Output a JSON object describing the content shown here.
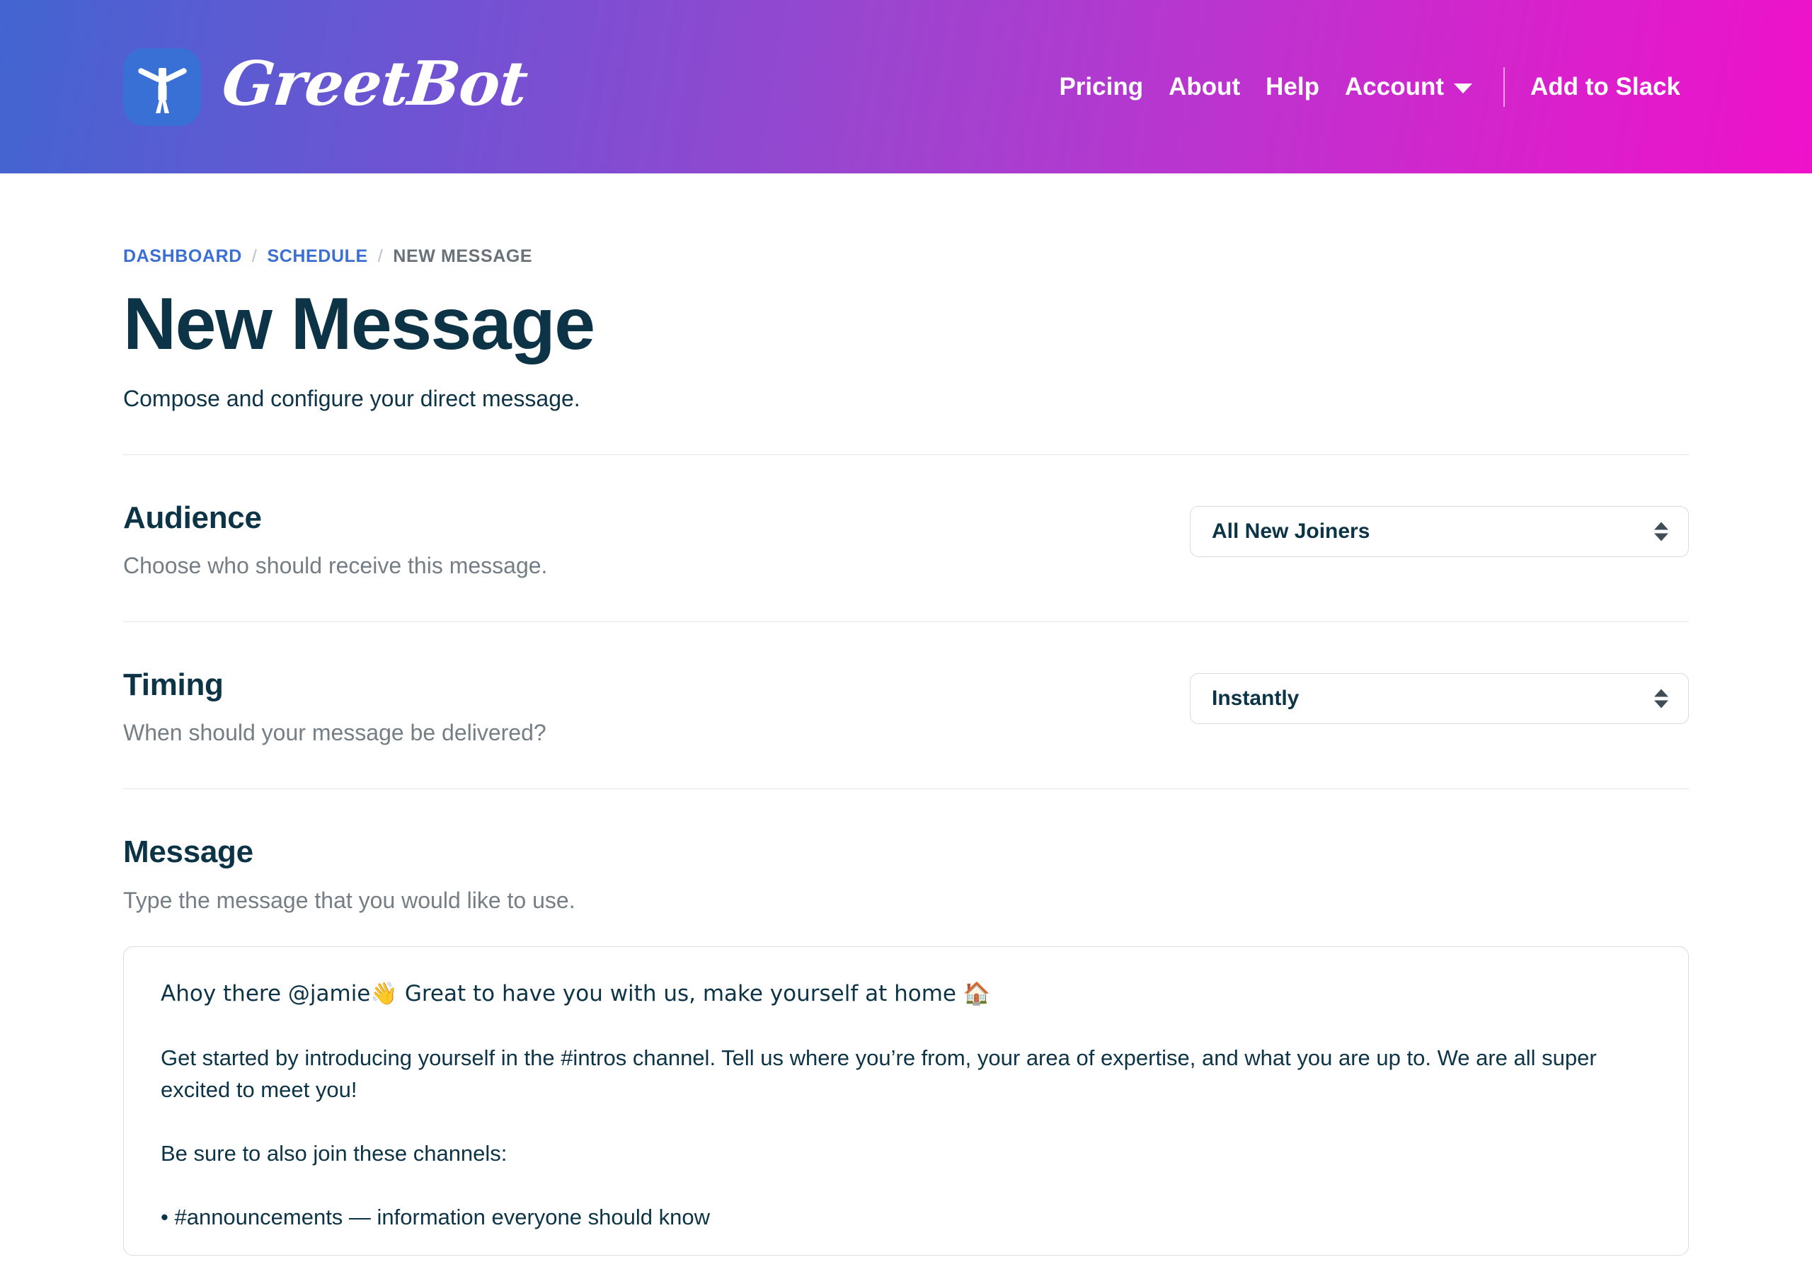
{
  "header": {
    "brand": {
      "name": "GreetBot",
      "icon": "person-arms-raised-icon",
      "mark_color": "#3870d6"
    },
    "nav": [
      {
        "label": "Pricing"
      },
      {
        "label": "About"
      },
      {
        "label": "Help"
      }
    ],
    "account": {
      "label": "Account",
      "caret_icon": "chevron-down-icon"
    },
    "cta": {
      "label": "Add to Slack"
    },
    "gradient_from": "#4265d0",
    "gradient_to": "#ef11cb"
  },
  "breadcrumb": {
    "items": [
      {
        "label": "DASHBOARD",
        "current": false
      },
      {
        "label": "SCHEDULE",
        "current": false
      },
      {
        "label": "NEW MESSAGE",
        "current": true
      }
    ],
    "separator": "/",
    "link_color": "#3b6fd4"
  },
  "page": {
    "title": "New Message",
    "subtitle": "Compose and configure your direct message."
  },
  "sections": {
    "audience": {
      "title": "Audience",
      "description": "Choose who should receive this message.",
      "select": {
        "value": "All New Joiners",
        "stepper_icon": "up-down-stepper-icon"
      }
    },
    "timing": {
      "title": "Timing",
      "description": "When should your message be delivered?",
      "select": {
        "value": "Instantly",
        "stepper_icon": "up-down-stepper-icon"
      }
    },
    "message": {
      "title": "Message",
      "description": "Type the message that you would like to use.",
      "body": {
        "line1": "Ahoy there @jamie👋 Great to have you with us, make yourself at home 🏠",
        "line2": "Get started by introducing yourself in the #intros channel. Tell us where you’re from, your area of expertise, and what you are up to. We are all super excited to meet you!",
        "line3": "Be sure to also join these channels:",
        "line4": "• #announcements — information everyone should know"
      }
    }
  },
  "colors": {
    "heading": "#0d3446",
    "muted": "#757e85",
    "border": "#d8dde2"
  }
}
